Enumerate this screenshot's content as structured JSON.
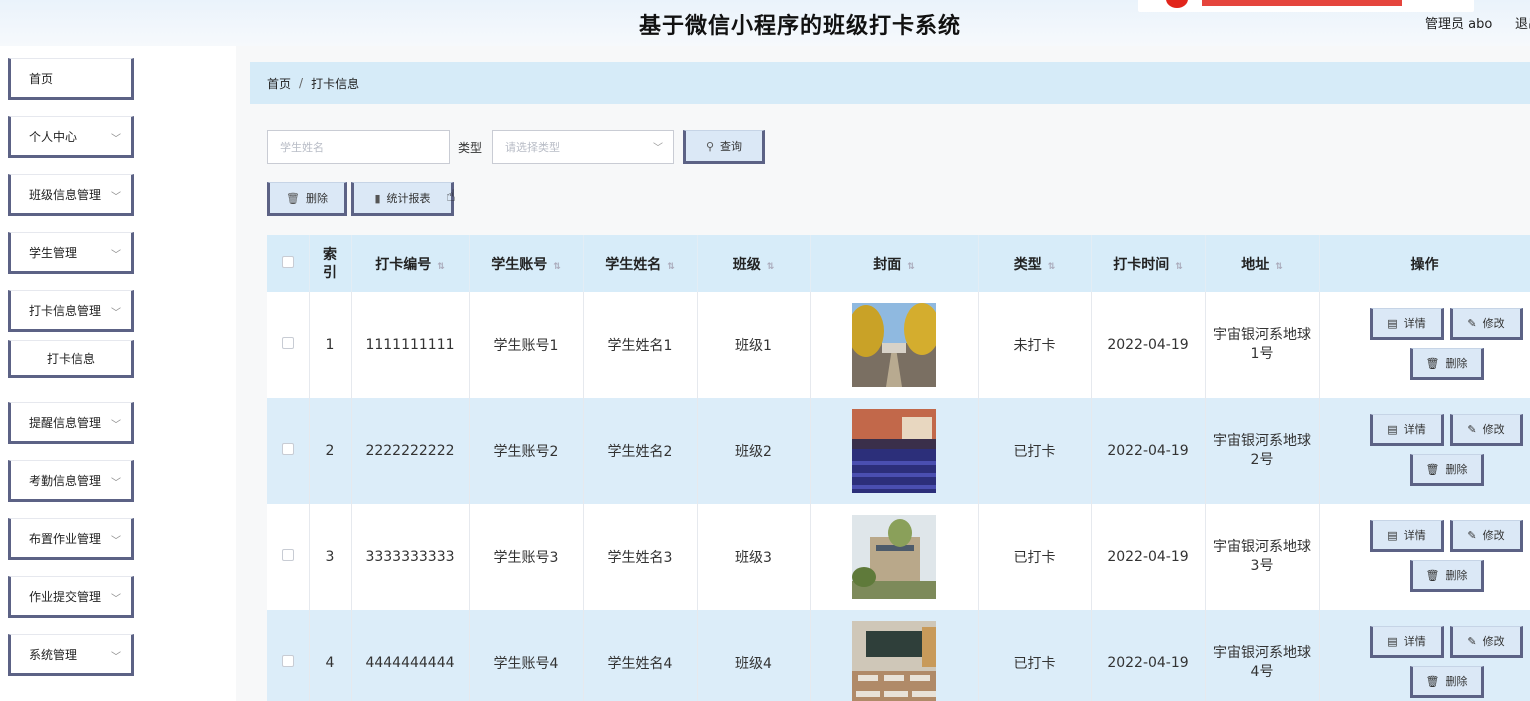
{
  "header": {
    "title": "基于微信小程序的班级打卡系统",
    "admin": "管理员 abo",
    "logout": "退出"
  },
  "sidebar": {
    "items": [
      {
        "label": "首页"
      },
      {
        "label": "个人中心"
      },
      {
        "label": "班级信息管理"
      },
      {
        "label": "学生管理"
      },
      {
        "label": "打卡信息管理"
      },
      {
        "label": "打卡信息"
      },
      {
        "label": "提醒信息管理"
      },
      {
        "label": "考勤信息管理"
      },
      {
        "label": "布置作业管理"
      },
      {
        "label": "作业提交管理"
      },
      {
        "label": "系统管理"
      }
    ]
  },
  "breadcrumb": {
    "home": "首页",
    "sep": "/",
    "current": "打卡信息"
  },
  "search": {
    "name_placeholder": "学生姓名",
    "type_label": "类型",
    "type_placeholder": "请选择类型",
    "query_button": "查询"
  },
  "toolbar": {
    "delete": "删除",
    "report": "统计报表"
  },
  "table": {
    "headers": [
      "",
      "索\n引",
      "打卡编号",
      "学生账号",
      "学生姓名",
      "班级",
      "封面",
      "类型",
      "打卡时间",
      "地址",
      "操作"
    ],
    "rows": [
      {
        "index": "1",
        "no": "1111111111",
        "account": "学生账号1",
        "name": "学生姓名1",
        "class": "班级1",
        "cover": "campus-tree-road",
        "type": "未打卡",
        "time": "2022-04-19",
        "addr": "宇宙银河系地球1号"
      },
      {
        "index": "2",
        "no": "2222222222",
        "account": "学生账号2",
        "name": "学生姓名2",
        "class": "班级2",
        "cover": "auditorium",
        "type": "已打卡",
        "time": "2022-04-19",
        "addr": "宇宙银河系地球2号"
      },
      {
        "index": "3",
        "no": "3333333333",
        "account": "学生账号3",
        "name": "学生姓名3",
        "class": "班级3",
        "cover": "building-garden",
        "type": "已打卡",
        "time": "2022-04-19",
        "addr": "宇宙银河系地球3号"
      },
      {
        "index": "4",
        "no": "4444444444",
        "account": "学生账号4",
        "name": "学生姓名4",
        "class": "班级4",
        "cover": "classroom",
        "type": "已打卡",
        "time": "2022-04-19",
        "addr": "宇宙银河系地球4号"
      }
    ],
    "ops": {
      "detail": "详情",
      "edit": "修改",
      "delete": "删除"
    }
  },
  "colors": {
    "accent_border": "#5c6285",
    "header_row": "#d7ecf9",
    "stripe": "#dcedf9"
  }
}
